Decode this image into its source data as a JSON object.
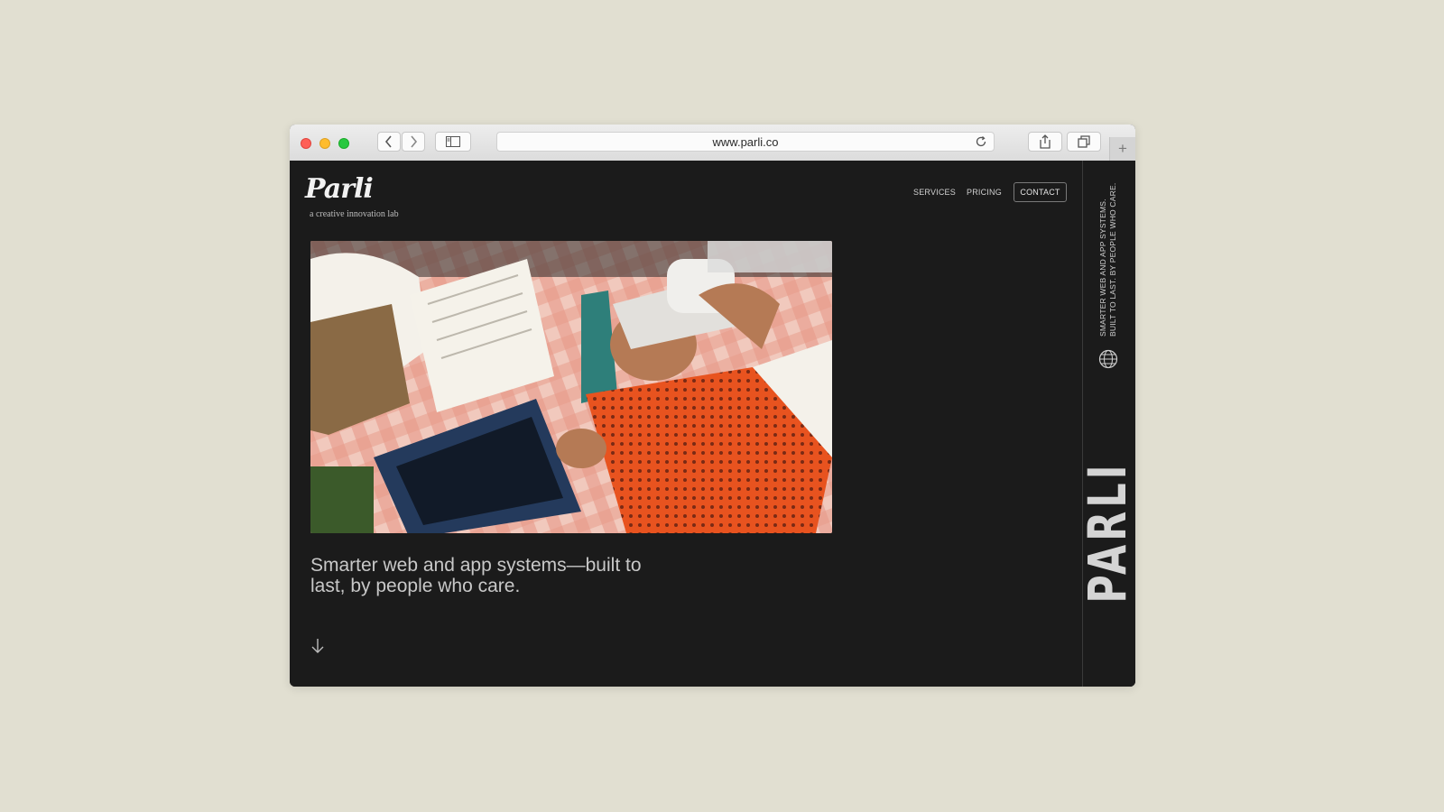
{
  "browser": {
    "url": "www.parli.co"
  },
  "site": {
    "logo": "Parli",
    "tagline": "a creative innovation lab",
    "nav": {
      "services": "SERVICES",
      "pricing": "PRICING",
      "contact": "CONTACT"
    },
    "headline": "Smarter web and app systems—built to last, by people who care.",
    "sidebar_tagline_line1": "SMARTER WEB AND APP SYSTEMS.",
    "sidebar_tagline_line2": "BUILT TO LAST. BY PEOPLE WHO CARE.",
    "sidebar_wordmark": "PARLI"
  },
  "icons": [
    "back-arrow-icon",
    "forward-arrow-icon",
    "sidebar-toggle-icon",
    "reload-icon",
    "share-icon",
    "tabs-overview-icon",
    "new-tab-icon",
    "globe-icon",
    "down-arrow-icon"
  ],
  "colors": {
    "page_bg": "#e1dfd1",
    "site_bg": "#1b1b1b",
    "accent_orange": "#e8531f"
  }
}
